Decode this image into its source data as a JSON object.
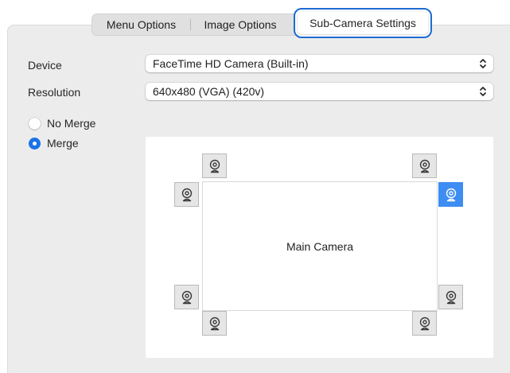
{
  "tabs": {
    "items": [
      {
        "label": "Menu Options"
      },
      {
        "label": "Image Options"
      },
      {
        "label": "Sub-Camera Settings"
      }
    ],
    "selected": "Sub-Camera Settings"
  },
  "form": {
    "device_label": "Device",
    "device_value": "FaceTime HD Camera (Built-in)",
    "resolution_label": "Resolution",
    "resolution_value": "640x480 (VGA) (420v)"
  },
  "merge": {
    "options": [
      {
        "label": "No Merge",
        "selected": false
      },
      {
        "label": "Merge",
        "selected": true
      }
    ]
  },
  "preview": {
    "main_label": "Main Camera",
    "positions": [
      {
        "name": "top-left",
        "icon": "webcam-icon",
        "selected": false
      },
      {
        "name": "top-right",
        "icon": "webcam-icon",
        "selected": false
      },
      {
        "name": "left-top",
        "icon": "webcam-icon",
        "selected": false
      },
      {
        "name": "right-top",
        "icon": "webcam-icon",
        "selected": true
      },
      {
        "name": "left-bottom",
        "icon": "webcam-icon",
        "selected": false
      },
      {
        "name": "right-bottom",
        "icon": "webcam-icon",
        "selected": false
      },
      {
        "name": "bottom-left",
        "icon": "webcam-icon",
        "selected": false
      },
      {
        "name": "bottom-right",
        "icon": "webcam-icon",
        "selected": false
      }
    ]
  },
  "colors": {
    "accent": "#1a73e8",
    "selected_cam": "#3d8df2",
    "tab_focus_ring": "#1d6bd2"
  }
}
